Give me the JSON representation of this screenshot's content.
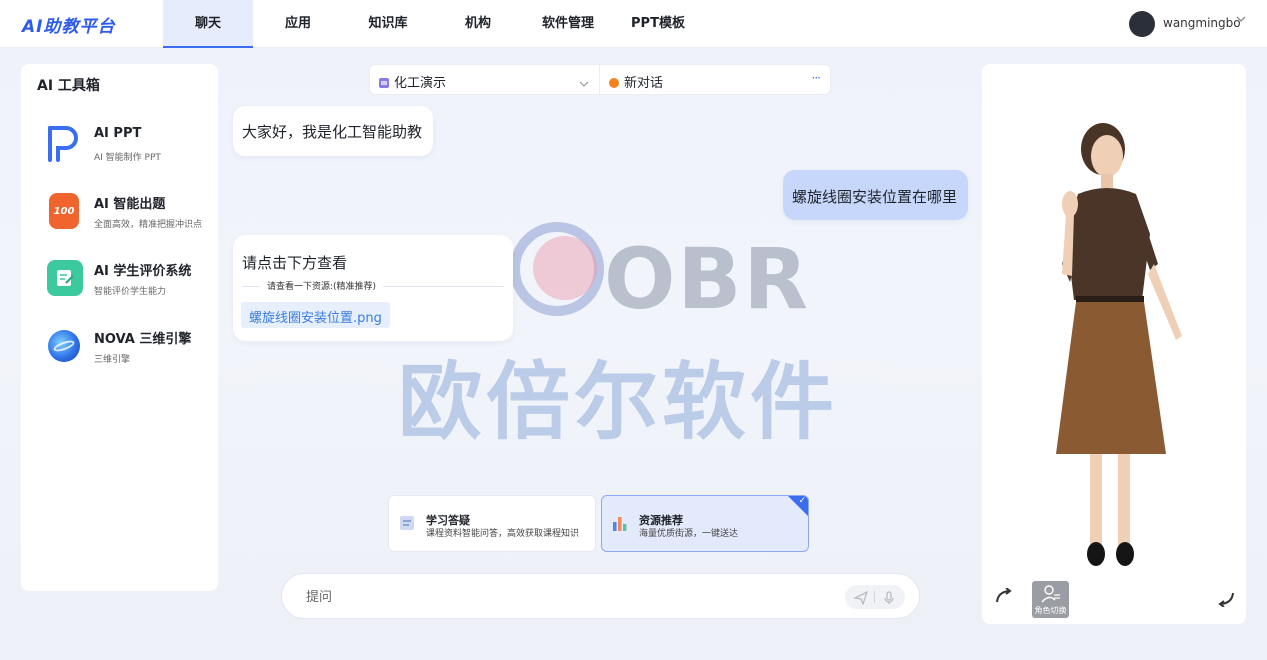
{
  "header": {
    "logo": "AI助教平台",
    "nav": [
      {
        "label": "聊天",
        "active": true
      },
      {
        "label": "应用",
        "active": false
      },
      {
        "label": "知识库",
        "active": false
      },
      {
        "label": "机构",
        "active": false
      },
      {
        "label": "软件管理",
        "active": false
      },
      {
        "label": "PPT模板",
        "active": false
      }
    ],
    "user": {
      "name": "wangmingbo",
      "chevron_icon": "chevron-down-icon"
    }
  },
  "sidebar": {
    "title": "AI 工具箱",
    "tools": [
      {
        "name": "AI PPT",
        "desc": "AI 智能制作 PPT",
        "icon": "ppt-p-icon",
        "color": "#3a6df0"
      },
      {
        "name": "AI 智能出题",
        "desc": "全面高效，精准把握冲识点",
        "icon": "score-100-icon",
        "color": "#f0642d"
      },
      {
        "name": "AI 学生评价系统",
        "desc": "智能评价学生能力",
        "icon": "edit-note-icon",
        "color": "#3cc99e"
      },
      {
        "name": "NOVA 三维引擎",
        "desc": "三维引擎",
        "icon": "globe-3d-icon",
        "color": "#2f72e8"
      }
    ]
  },
  "selectors": {
    "course": "化工演示",
    "conversation": "新对话"
  },
  "chat": {
    "greeting": "大家好，我是化工智能助教",
    "user_question": "螺旋线圈安装位置在哪里",
    "reply_title": "请点击下方查看",
    "reply_divider": "请查看一下资源:(精准推荐)",
    "resource_file": "螺旋线圈安装位置.png"
  },
  "watermark": {
    "brand": "OBR",
    "text": "欧倍尔软件"
  },
  "modes": [
    {
      "title": "学习答疑",
      "desc": "课程资料智能问答，高效获取课程知识",
      "selected": false
    },
    {
      "title": "资源推荐",
      "desc": "海量优质街源，一键送达",
      "selected": true
    }
  ],
  "input": {
    "placeholder": "提问"
  },
  "avatar_panel": {
    "role_switch_label": "角色切换"
  },
  "colors": {
    "accent": "#3a6df0",
    "user_bubble": "#c7d7fb",
    "selected_card": "#e3eafc"
  }
}
